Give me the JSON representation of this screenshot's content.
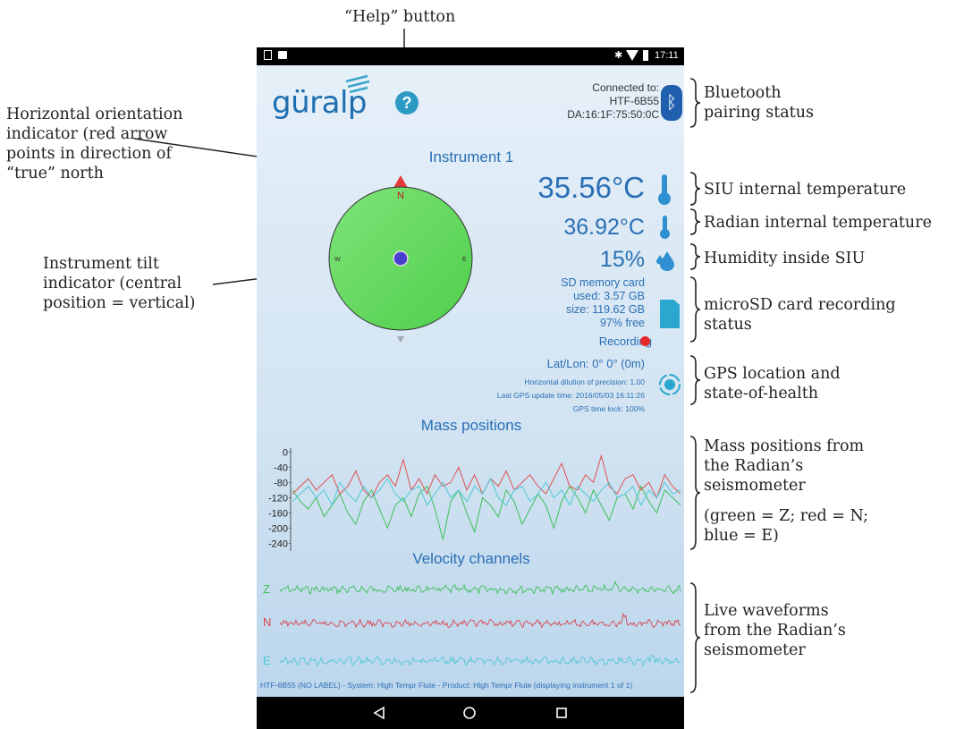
{
  "annotations": {
    "help": "“Help” button",
    "orientation": [
      "Horizontal orientation",
      "indicator (red arrow",
      "points in direction of",
      "“true” north"
    ],
    "tilt": [
      "Instrument tilt",
      "indicator (central",
      "position = vertical)"
    ],
    "bluetooth": [
      "Bluetooth",
      "pairing status"
    ],
    "siu_temp": "SIU internal temperature",
    "radian_temp": "Radian internal temperature",
    "humidity": "Humidity inside SIU",
    "sd": [
      "microSD card recording",
      "status"
    ],
    "gps": [
      "GPS location and",
      "state-of-health"
    ],
    "mass": [
      "Mass positions from",
      "the Radian’s",
      "seismometer",
      "(green = Z; red = N;",
      "blue = E)"
    ],
    "live": [
      "Live waveforms",
      "from the Radian’s",
      "seismometer"
    ]
  },
  "status_bar": {
    "time": "17:11"
  },
  "app": {
    "logo": "güralp",
    "connected_label": "Connected to:",
    "device_name": "HTF-6B55",
    "mac": "DA:16:1F:75:50:0C",
    "instrument_title": "Instrument 1",
    "compass": {
      "n": "N",
      "w": "W",
      "e": "E"
    },
    "siu_temp": "35.56°C",
    "radian_temp": "36.92°C",
    "humidity": "15%",
    "sd_title": "SD memory card",
    "sd_used": "used: 3.57 GB",
    "sd_size": "size: 119.62 GB",
    "sd_free": "97% free",
    "recording": "Recording",
    "latlon": "Lat/Lon: 0° 0° (0m)",
    "hdop": "Horizontal dilution of precision: 1.00",
    "gps_update": "Last GPS update time: 2016/05/03 16:11:26",
    "gps_lock": "GPS time lock: 100%",
    "mass_title": "Mass positions",
    "velocity_title": "Velocity channels",
    "channels": [
      "Z",
      "N",
      "E"
    ],
    "footer": "HTF-6B55 (NO LABEL) - System: High Tempr Flute - Product: High Tempr Flute (displaying instrument 1 of 1)"
  },
  "chart_data": {
    "type": "line",
    "title": "Mass positions",
    "yticks": [
      0,
      -40,
      -80,
      -120,
      -160,
      -200,
      -240
    ],
    "ylim": [
      -260,
      10
    ],
    "series": [
      {
        "name": "Z",
        "color": "#3fbf5a",
        "values": [
          -100,
          -130,
          -150,
          -120,
          -170,
          -140,
          -110,
          -160,
          -190,
          -130,
          -100,
          -150,
          -200,
          -140,
          -120,
          -170,
          -110,
          -90,
          -150,
          -230,
          -130,
          -100,
          -160,
          -210,
          -120,
          -140,
          -170,
          -100,
          -130,
          -190,
          -150,
          -110,
          -140,
          -200,
          -130,
          -90,
          -120,
          -160,
          -100,
          -140,
          -180,
          -120,
          -110,
          -150,
          -90,
          -130,
          -160,
          -100,
          -120,
          -140
        ]
      },
      {
        "name": "N",
        "color": "#e05050",
        "values": [
          -110,
          -90,
          -70,
          -100,
          -80,
          -60,
          -110,
          -90,
          -50,
          -100,
          -120,
          -80,
          -60,
          -90,
          -20,
          -100,
          -70,
          -110,
          -60,
          -90,
          -80,
          -40,
          -100,
          -60,
          -110,
          -70,
          -90,
          -50,
          -100,
          -80,
          -60,
          -90,
          -110,
          -70,
          -30,
          -90,
          -100,
          -60,
          -80,
          -10,
          -90,
          -110,
          -70,
          -60,
          -100,
          -80,
          -120,
          -60,
          -90,
          -110
        ]
      },
      {
        "name": "E",
        "color": "#4fc9d6",
        "values": [
          -130,
          -110,
          -90,
          -120,
          -100,
          -140,
          -80,
          -110,
          -130,
          -90,
          -120,
          -100,
          -70,
          -110,
          -130,
          -100,
          -90,
          -140,
          -110,
          -80,
          -120,
          -100,
          -130,
          -90,
          -110,
          -70,
          -120,
          -140,
          -100,
          -90,
          -130,
          -110,
          -80,
          -120,
          -100,
          -140,
          -90,
          -110,
          -130,
          -100,
          -80,
          -120,
          -110,
          -90,
          -140,
          -100,
          -120,
          -80,
          -110,
          -100
        ]
      }
    ]
  },
  "colors": {
    "z": "#3fbf5a",
    "n": "#d9434f",
    "e": "#4fc9d6",
    "accent": "#2a6fb5",
    "compass": "#6fe06a"
  }
}
